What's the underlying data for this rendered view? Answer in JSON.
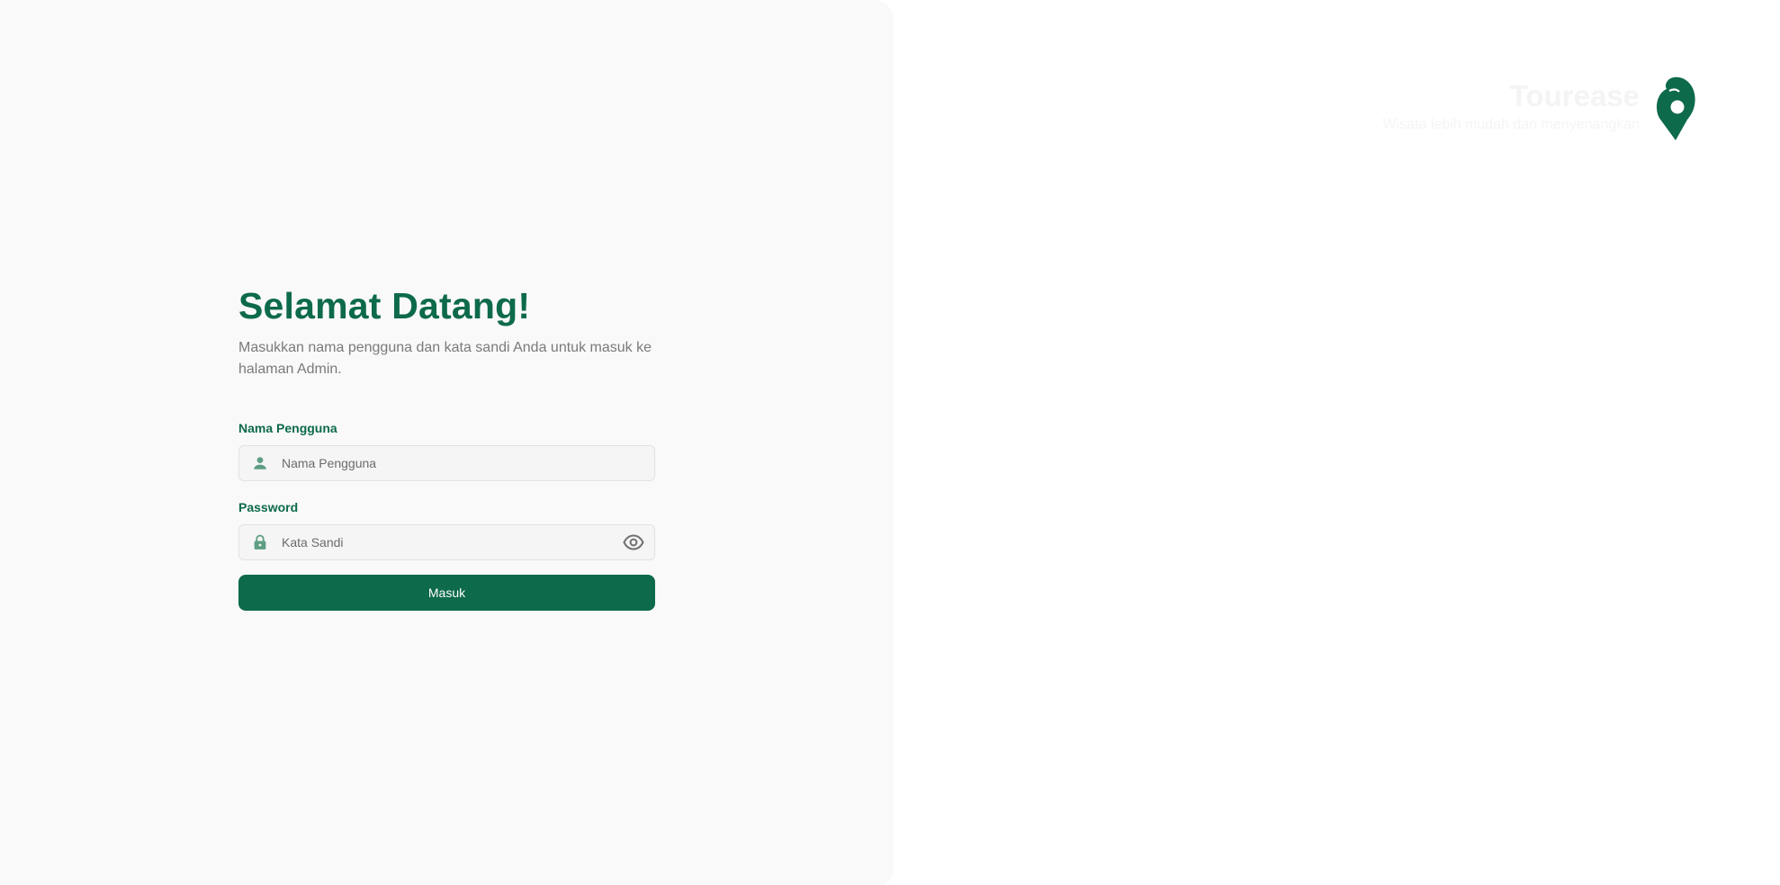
{
  "login": {
    "title": "Selamat Datang!",
    "subtitle": "Masukkan nama pengguna dan kata sandi Anda untuk masuk ke halaman Admin.",
    "username_label": "Nama Pengguna",
    "username_placeholder": "Nama Pengguna",
    "password_label": "Password",
    "password_placeholder": "Kata Sandi",
    "submit_label": "Masuk"
  },
  "brand": {
    "name": "Tourease",
    "tagline": "Wisata lebih mudah dan menyenangkan"
  },
  "icons": {
    "username": "user-icon",
    "password": "lock-icon",
    "toggle_visibility": "eye-icon",
    "logo": "location-pin-logo"
  },
  "colors": {
    "primary": "#0d6a4a",
    "icon_muted": "#5e9e83",
    "panel_bg": "#f9f9f9",
    "subtitle": "#7a7a7a"
  }
}
